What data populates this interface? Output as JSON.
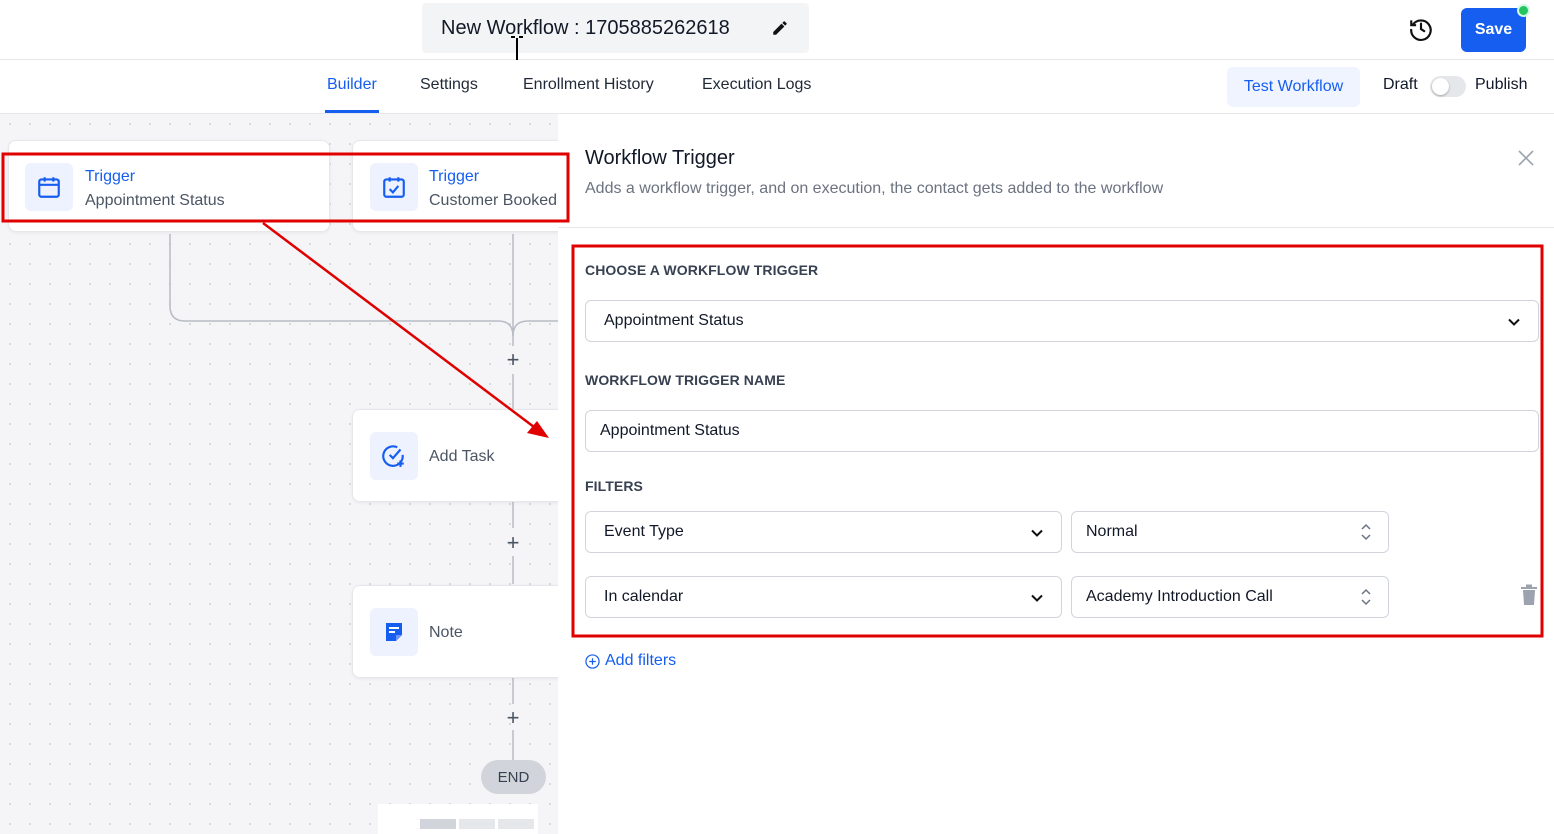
{
  "header": {
    "workflow_title": "New Workflow : 1705885262618",
    "save_label": "Save"
  },
  "tabs": [
    {
      "label": "Builder",
      "active": true
    },
    {
      "label": "Settings",
      "active": false
    },
    {
      "label": "Enrollment History",
      "active": false
    },
    {
      "label": "Execution Logs",
      "active": false
    }
  ],
  "toolbar": {
    "test_workflow_label": "Test Workflow",
    "draft_label": "Draft",
    "publish_label": "Publish",
    "published": false
  },
  "canvas": {
    "triggers": [
      {
        "title": "Trigger",
        "subtitle": "Appointment Status",
        "icon": "calendar-icon"
      },
      {
        "title": "Trigger",
        "subtitle": "Customer Booked",
        "icon": "calendar-check-icon"
      }
    ],
    "actions": [
      {
        "label": "Add Task",
        "icon": "task-check-icon"
      },
      {
        "label": "Note",
        "icon": "note-icon"
      }
    ],
    "end_label": "END",
    "plus_symbol": "+"
  },
  "panel": {
    "title": "Workflow Trigger",
    "description": "Adds a workflow trigger, and on execution, the contact gets added to the workflow",
    "choose_trigger_label": "CHOOSE A WORKFLOW TRIGGER",
    "trigger_value": "Appointment Status",
    "trigger_name_label": "WORKFLOW TRIGGER NAME",
    "trigger_name_value": "Appointment Status",
    "filters_label": "FILTERS",
    "filters": [
      {
        "field": "Event Type",
        "value": "Normal"
      },
      {
        "field": "In calendar",
        "value": "Academy Introduction Call"
      }
    ],
    "add_filters_label": "Add filters"
  },
  "colors": {
    "accent": "#155eef",
    "annotation": "#e00000",
    "status_online": "#22c55e"
  }
}
